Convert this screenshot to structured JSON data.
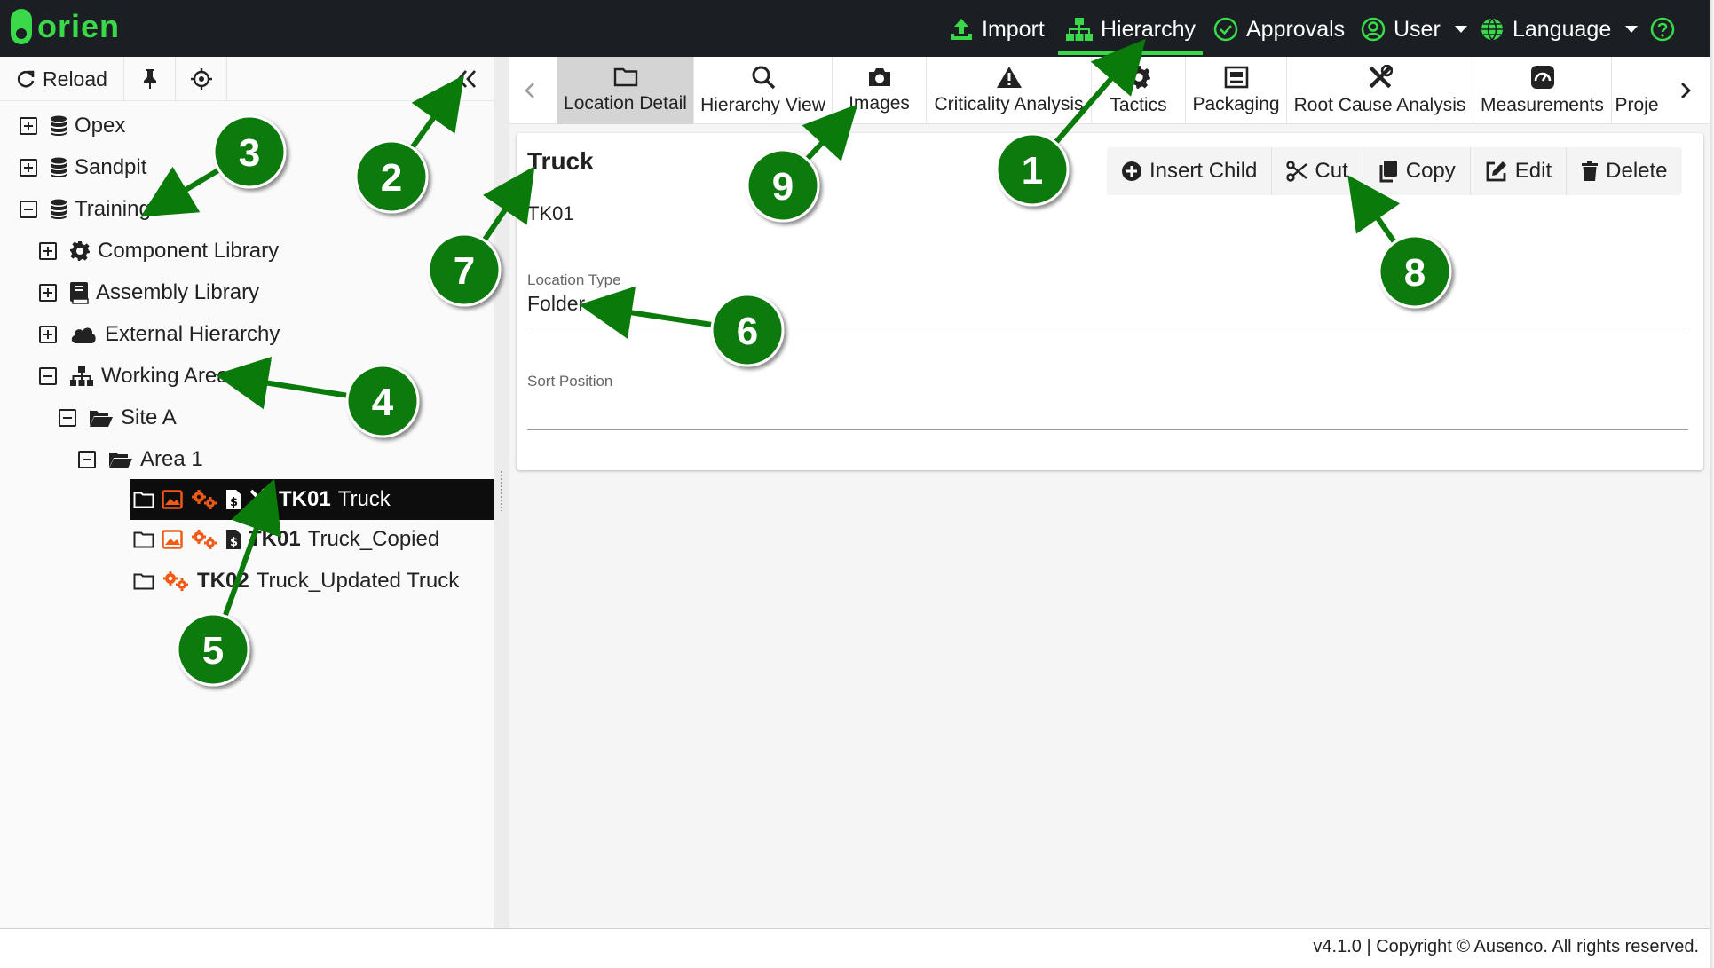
{
  "app": {
    "logo_text": "orien",
    "brand_color": "#3ad94a"
  },
  "navbar": {
    "import_label": "Import",
    "hierarchy_label": "Hierarchy",
    "approvals_label": "Approvals",
    "user_label": "User",
    "language_label": "Language",
    "active": "Hierarchy"
  },
  "left_toolbar": {
    "reload_label": "Reload",
    "pin_icon": "thumbtack-icon",
    "locate_icon": "crosshairs-icon",
    "collapse_icon": "double-chevron-left-icon"
  },
  "tree": {
    "opex": "Opex",
    "sandpit": "Sandpit",
    "training": "Training",
    "component_library": "Component Library",
    "assembly_library": "Assembly Library",
    "external_hierarchy": "External Hierarchy",
    "working_area": "Working Area",
    "site_a": "Site A",
    "area_1": "Area 1",
    "items": [
      {
        "code": "TK01",
        "name": "Truck"
      },
      {
        "code": "TK01",
        "name": "Truck_Copied"
      },
      {
        "code": "TK02",
        "name": "Truck_Updated Truck"
      }
    ]
  },
  "tabs": {
    "location_detail": "Location Detail",
    "hierarchy_view": "Hierarchy View",
    "images": "Images",
    "criticality_analysis": "Criticality Analysis",
    "tactics": "Tactics",
    "packaging": "Packaging",
    "root_cause_analysis": "Root Cause Analysis",
    "measurements": "Measurements",
    "projects_partial": "Proje",
    "active": "Location Detail"
  },
  "detail": {
    "title": "Truck",
    "code": "TK01",
    "location_type_label": "Location Type",
    "location_type_value": "Folder",
    "sort_position_label": "Sort Position",
    "sort_position_value": "",
    "actions": {
      "insert_child": "Insert Child",
      "cut": "Cut",
      "copy": "Copy",
      "edit": "Edit",
      "delete": "Delete"
    }
  },
  "footer": {
    "text": "v4.1.0 | Copyright © Ausenco. All rights reserved."
  },
  "callouts": {
    "color": "#0a7a0a",
    "labels": [
      "1",
      "2",
      "3",
      "4",
      "5",
      "6",
      "7",
      "8",
      "9"
    ]
  }
}
